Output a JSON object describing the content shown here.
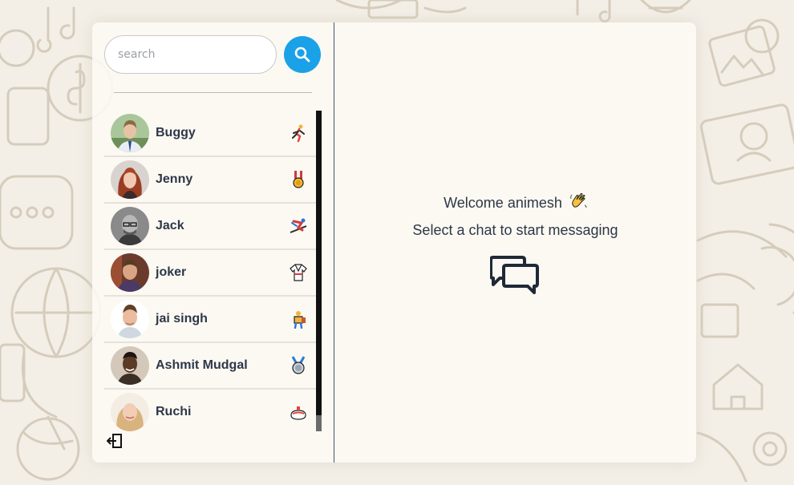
{
  "search": {
    "placeholder": "search",
    "value": ""
  },
  "icons": {
    "search": "search-icon",
    "logout": "logout-icon",
    "chat": "chat-bubbles-icon",
    "wave": "waving-hand-icon"
  },
  "colors": {
    "accent": "#1aa1e8",
    "text": "#2d3748",
    "panel": "#fcf9f3"
  },
  "users": [
    {
      "name": "Buggy",
      "status_icon": "runner-icon"
    },
    {
      "name": "Jenny",
      "status_icon": "military-medal-icon"
    },
    {
      "name": "Jack",
      "status_icon": "skier-icon"
    },
    {
      "name": "joker",
      "status_icon": "martial-arts-uniform-icon"
    },
    {
      "name": "jai singh",
      "status_icon": "person-climbing-icon"
    },
    {
      "name": "Ashmit Mudgal",
      "status_icon": "second-place-medal-icon"
    },
    {
      "name": "Ruchi",
      "status_icon": "curling-stone-icon"
    }
  ],
  "welcome": {
    "greeting": "Welcome animesh",
    "instruction": "Select a chat to start messaging"
  }
}
